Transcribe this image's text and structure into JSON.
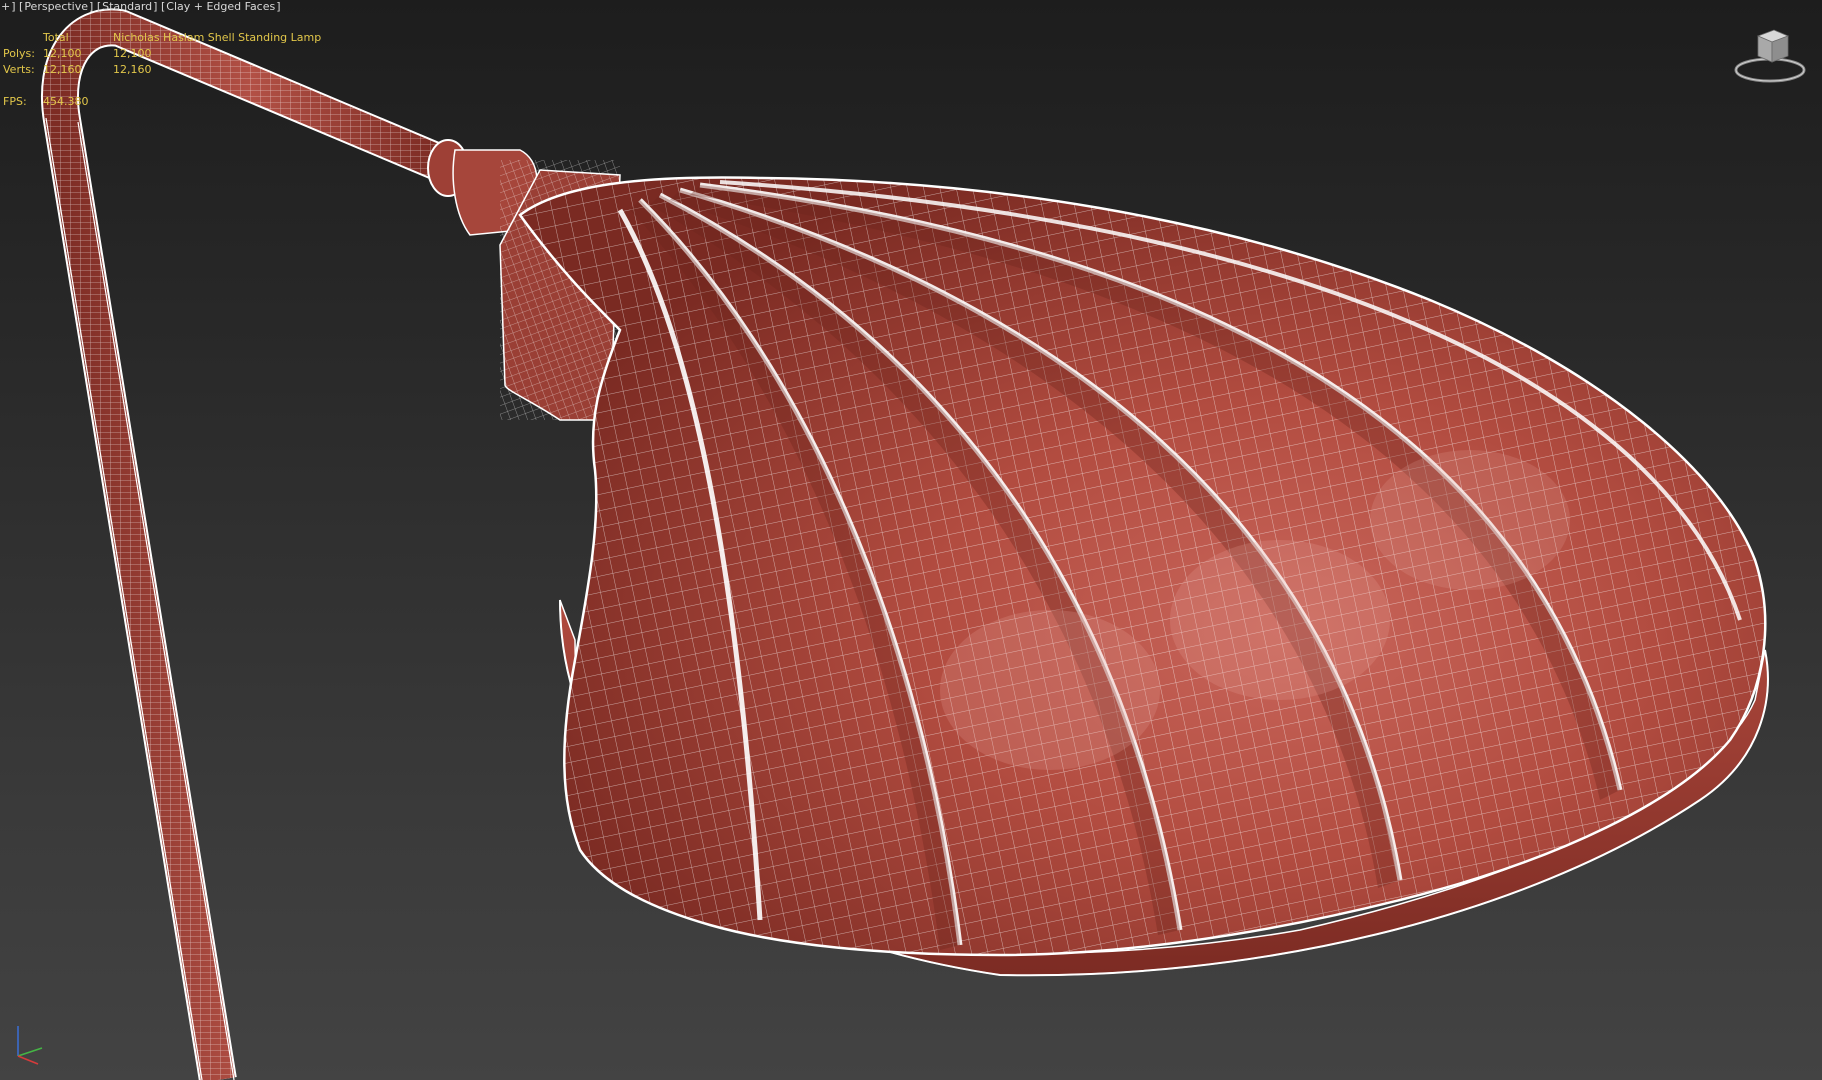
{
  "viewport_label": {
    "plus": "+",
    "view": "Perspective",
    "shading_mode": "Standard",
    "display_mode": "Clay + Edged Faces"
  },
  "stats": {
    "header_total": "Total",
    "header_object": "Nicholas Haslam Shell Standing Lamp",
    "polys_label": "Polys:",
    "polys_total": "12,100",
    "polys_object": "12,100",
    "verts_label": "Verts:",
    "verts_total": "12,160",
    "verts_object": "12,160",
    "fps_label": "FPS:",
    "fps_value": "454.380"
  },
  "colors": {
    "stats_text": "#e2c74a",
    "label_text": "#d8d8d8",
    "clay": "#a8463a",
    "wire": "#ffffff",
    "background_top": "#1d1d1d",
    "background_bottom": "#434343"
  },
  "icons": {
    "viewcube": "viewcube-icon",
    "axis": "axis-tripod-icon"
  }
}
